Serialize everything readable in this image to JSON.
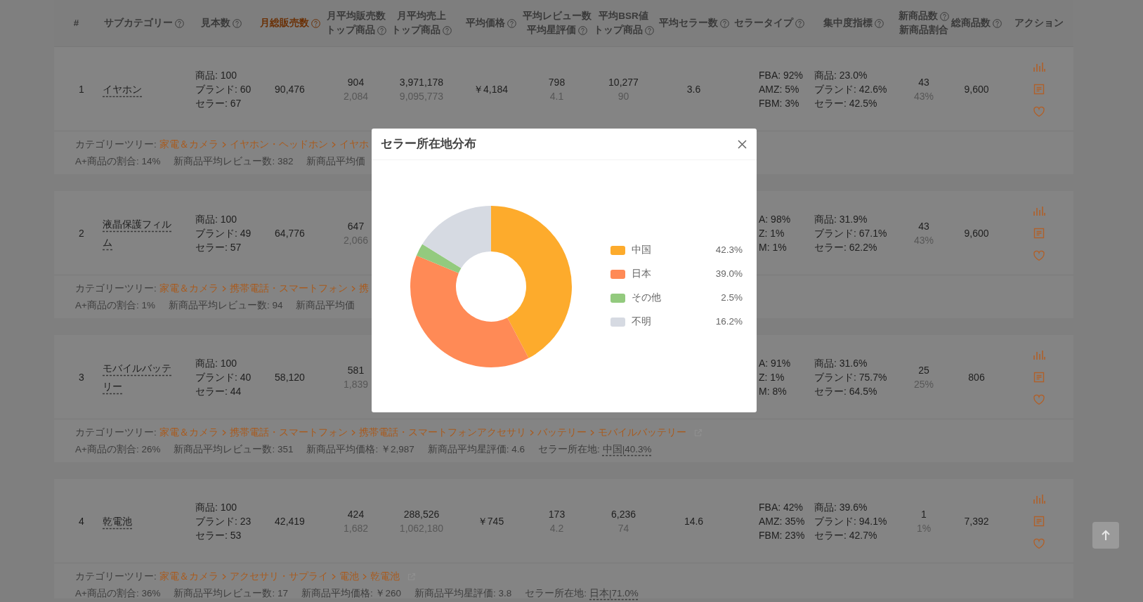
{
  "columns": [
    {
      "lines": [
        {
          "text": "#",
          "help": false
        }
      ],
      "sorted": false
    },
    {
      "lines": [
        {
          "text": "サブカテゴリー",
          "help": true
        }
      ],
      "sorted": false
    },
    {
      "lines": [
        {
          "text": "見本数",
          "help": true
        }
      ],
      "sorted": false
    },
    {
      "lines": [
        {
          "text": "月総販売数",
          "help": true
        }
      ],
      "sorted": true
    },
    {
      "lines": [
        {
          "text": "月平均販売数",
          "help": false
        },
        {
          "text": "トップ商品",
          "help": true
        }
      ],
      "sorted": false
    },
    {
      "lines": [
        {
          "text": "月平均売上",
          "help": false
        },
        {
          "text": "トップ商品",
          "help": true
        }
      ],
      "sorted": false
    },
    {
      "lines": [
        {
          "text": "平均価格",
          "help": true
        }
      ],
      "sorted": false
    },
    {
      "lines": [
        {
          "text": "平均レビュー数",
          "help": false
        },
        {
          "text": "平均星評価",
          "help": true
        }
      ],
      "sorted": false
    },
    {
      "lines": [
        {
          "text": "平均BSR値",
          "help": false
        },
        {
          "text": "トップ商品",
          "help": true
        }
      ],
      "sorted": false
    },
    {
      "lines": [
        {
          "text": "平均セラー数",
          "help": true
        }
      ],
      "sorted": false
    },
    {
      "lines": [
        {
          "text": "セラータイプ",
          "help": true
        }
      ],
      "sorted": false
    },
    {
      "lines": [
        {
          "text": "集中度指標",
          "help": true
        }
      ],
      "sorted": false
    },
    {
      "lines": [
        {
          "text": "新商品数",
          "help": true
        },
        {
          "text": "新商品割合",
          "help": false
        }
      ],
      "sorted": false
    },
    {
      "lines": [
        {
          "text": "総商品数",
          "help": true
        }
      ],
      "sorted": false
    },
    {
      "lines": [
        {
          "text": "アクション",
          "help": false
        }
      ],
      "sorted": false
    }
  ],
  "rows": [
    {
      "index": "1",
      "name": "イヤホン",
      "samples": [
        "商品: 100",
        "ブランド: 60",
        "セラー: 67"
      ],
      "monthly_sales": "90,476",
      "avg_sales": [
        "904",
        "2,084"
      ],
      "avg_revenue": [
        "3,971,178",
        "9,095,773"
      ],
      "avg_price": "￥4,184",
      "reviews": [
        "798",
        "4.1"
      ],
      "bsr": [
        "10,277",
        "90"
      ],
      "sellers": "3.6",
      "seller_types": [
        "FBA: 92%",
        "AMZ: 5%",
        "FBM: 3%"
      ],
      "concentration": [
        "商品: 23.0%",
        "ブランド: 42.6%",
        "セラー: 42.5%"
      ],
      "new_products": [
        "43",
        "43%"
      ],
      "total": "9,600",
      "tree_label": "カテゴリーツリー:",
      "category_path": [
        "家電＆カメラ",
        "イヤホン・ヘッドホン",
        "イヤホ"
      ],
      "external_link": false,
      "stats": [
        {
          "text": "A+商品の割合: 14%"
        },
        {
          "text": "新商品平均レビュー数: 382"
        },
        {
          "text": "新商品平均価"
        }
      ]
    },
    {
      "index": "2",
      "name": "液晶保護フィルム",
      "samples": [
        "商品: 100",
        "ブランド: 49",
        "セラー: 57"
      ],
      "monthly_sales": "64,776",
      "avg_sales": [
        "647",
        "2,066"
      ],
      "seller_types": [
        "A: 98%",
        "Z: 1%",
        "M: 1%"
      ],
      "concentration": [
        "商品: 31.9%",
        "ブランド: 67.1%",
        "セラー: 62.2%"
      ],
      "new_products": [
        "43",
        "43%"
      ],
      "total": "9,600",
      "tree_label": "カテゴリーツリー:",
      "category_path": [
        "家電＆カメラ",
        "携帯電話・スマートフォン",
        "携"
      ],
      "external_link": false,
      "stats": [
        {
          "text": "A+商品の割合: 1%"
        },
        {
          "text": "新商品平均レビュー数: 94"
        },
        {
          "text": "新商品平均価"
        }
      ]
    },
    {
      "index": "3",
      "name": "モバイルバッテリー",
      "samples": [
        "商品: 100",
        "ブランド: 40",
        "セラー: 44"
      ],
      "monthly_sales": "58,120",
      "avg_sales": [
        "581",
        "1,839"
      ],
      "seller_types": [
        "A: 91%",
        "Z: 1%",
        "M: 8%"
      ],
      "concentration": [
        "商品: 31.6%",
        "ブランド: 75.7%",
        "セラー: 64.5%"
      ],
      "new_products": [
        "25",
        "25%"
      ],
      "total": "806",
      "tree_label": "カテゴリーツリー:",
      "category_path": [
        "家電＆カメラ",
        "携帯電話・スマートフォン",
        "携帯電話・スマートフォンアクセサリ",
        "バッテリー",
        "モバイルバッテリー"
      ],
      "external_link": true,
      "stats": [
        {
          "text": "A+商品の割合: 26%"
        },
        {
          "text": "新商品平均レビュー数: 351"
        },
        {
          "text": "新商品平均価格: ￥2,987"
        },
        {
          "text": "新商品平均星評価: 4.6"
        },
        {
          "text": "セラー所在地:",
          "link": "中国|40.3%"
        }
      ]
    },
    {
      "index": "4",
      "name": "乾電池",
      "samples": [
        "商品: 100",
        "ブランド: 23",
        "セラー: 53"
      ],
      "monthly_sales": "42,419",
      "avg_sales": [
        "424",
        "1,682"
      ],
      "avg_revenue": [
        "288,526",
        "1,062,180"
      ],
      "avg_price": "￥745",
      "reviews": [
        "173",
        "4.2"
      ],
      "bsr": [
        "6,236",
        "74"
      ],
      "sellers": "14.6",
      "seller_types": [
        "FBA: 42%",
        "AMZ: 35%",
        "FBM: 23%"
      ],
      "concentration": [
        "商品: 39.6%",
        "ブランド: 94.1%",
        "セラー: 42.7%"
      ],
      "new_products": [
        "1",
        "1%"
      ],
      "total": "7,392",
      "tree_label": "カテゴリーツリー:",
      "category_path": [
        "家電＆カメラ",
        "アクセサリ・サプライ",
        "電池",
        "乾電池"
      ],
      "external_link": true,
      "stats": [
        {
          "text": "A+商品の割合: 36%"
        },
        {
          "text": "新商品平均レビュー数: 17"
        },
        {
          "text": "新商品平均価格: ￥260"
        },
        {
          "text": "新商品平均星評価: 3.8"
        },
        {
          "text": "セラー所在地:",
          "link": "日本|71.0%"
        }
      ]
    }
  ],
  "modal": {
    "title": "セラー所在地分布",
    "chart_data": {
      "type": "donut",
      "categories": [
        "中国",
        "日本",
        "その他",
        "不明"
      ],
      "values": [
        42.3,
        39.0,
        2.5,
        16.2
      ]
    },
    "legend": [
      {
        "color": "#fdab2c",
        "reading": "42.3%"
      },
      {
        "color": "#ff8a56",
        "reading": "39.0%"
      },
      {
        "color": "#93ca7e",
        "reading": "2.5%"
      },
      {
        "color": "#d6dae2",
        "reading": "16.2%"
      }
    ]
  }
}
